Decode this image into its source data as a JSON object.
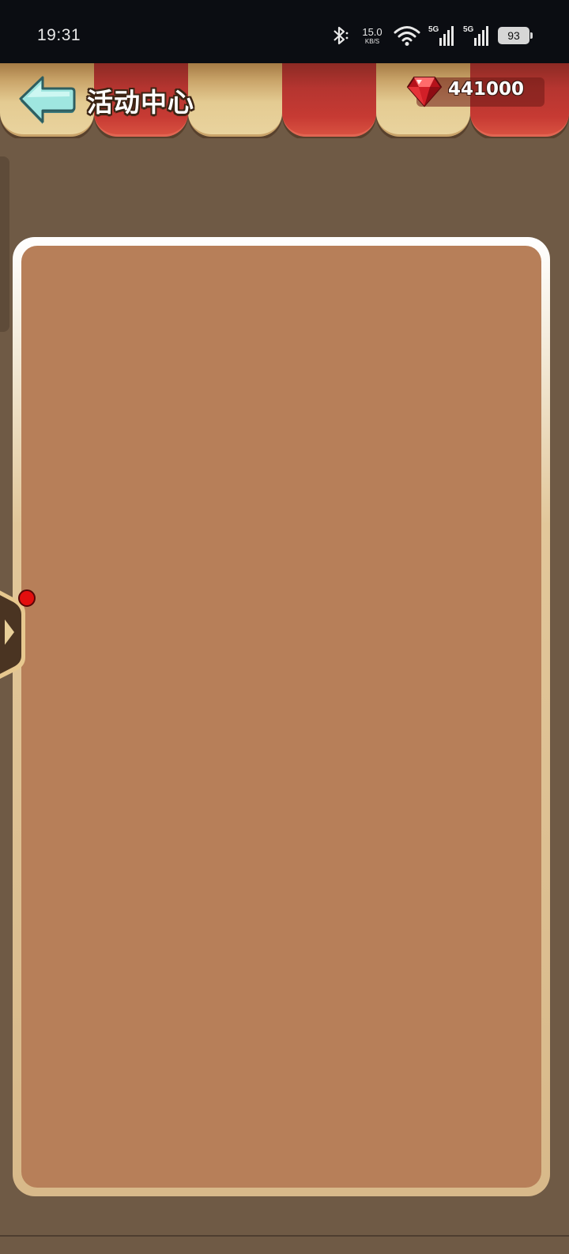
{
  "status_bar": {
    "time": "19:31",
    "net_speed_value": "15.0",
    "net_speed_unit": "KB/S",
    "signal_1_label": "5G",
    "signal_2_label": "5G",
    "battery": "93",
    "icons": [
      "bluetooth-icon",
      "wifi-icon",
      "signal-icon",
      "signal-icon",
      "battery-icon"
    ]
  },
  "header": {
    "title": "活动中心",
    "gem_count": "441000",
    "back_icon": "back-arrow-icon",
    "currency_icon": "ruby-gem-icon"
  },
  "side_tab": {
    "icon": "chevron-right-icon",
    "has_notification": true
  },
  "colors": {
    "background": "#6f5a45",
    "panel": "#b77f59",
    "awning_red": "#c63a33",
    "awning_tan": "#e9d39e",
    "notification": "#e30e0e"
  }
}
